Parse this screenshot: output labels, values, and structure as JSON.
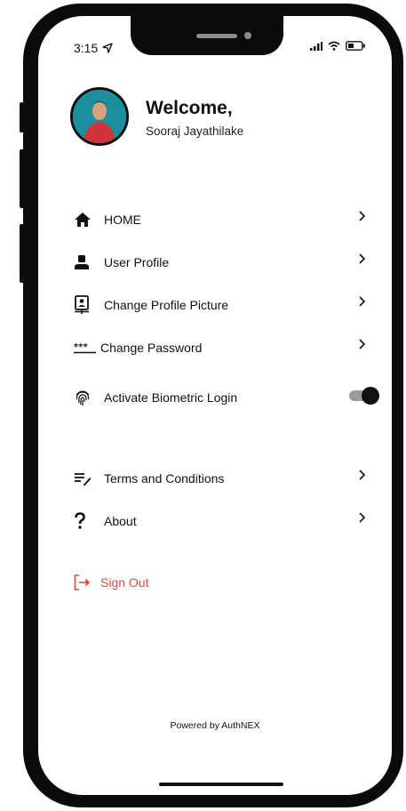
{
  "status": {
    "time": "3:15"
  },
  "profile": {
    "greeting": "Welcome,",
    "name": "Sooraj Jayathilake"
  },
  "menu": [
    {
      "label": "HOME",
      "icon": "home-icon",
      "action": "chevron"
    },
    {
      "label": "User Profile",
      "icon": "user-icon",
      "action": "chevron"
    },
    {
      "label": "Change Profile Picture",
      "icon": "id-badge-icon",
      "action": "chevron"
    },
    {
      "label": "Change Password",
      "icon": "password-icon",
      "action": "chevron"
    },
    {
      "label": "Activate Biometric Login",
      "icon": "fingerprint-icon",
      "action": "toggle",
      "toggle_on": true
    },
    {
      "label": "Terms and Conditions",
      "icon": "terms-icon",
      "action": "chevron"
    },
    {
      "label": "About",
      "icon": "question-icon",
      "action": "chevron"
    }
  ],
  "signout": {
    "label": "Sign Out",
    "icon": "sign-out-icon",
    "color": "#e04a3b"
  },
  "footer": {
    "powered_by": "Powered by AuthNEX"
  },
  "colors": {
    "avatar_bg": "#1b8f9e",
    "toggle_track": "#9a9a9a",
    "toggle_knob": "#111111"
  }
}
